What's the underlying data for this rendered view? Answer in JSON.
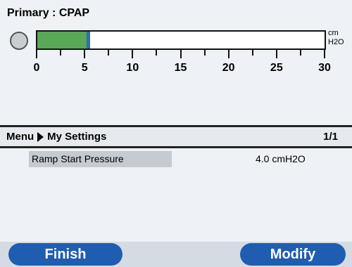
{
  "header": {
    "mode_title": "Primary : CPAP"
  },
  "pressure_gauge": {
    "value_cmH2O": 5.5,
    "min": 0,
    "max": 30,
    "unit_line1": "cm",
    "unit_line2": "H2O",
    "tick_labels": [
      "0",
      "5",
      "10",
      "15",
      "20",
      "25",
      "30"
    ],
    "fill_color": "#58a855",
    "marker_color": "#2c6fb4"
  },
  "menu": {
    "breadcrumb_root": "Menu",
    "breadcrumb_current": "My Settings",
    "page_indicator": "1/1"
  },
  "settings": [
    {
      "label": "Ramp Start Pressure",
      "value": "4.0 cmH2O"
    }
  ],
  "softkeys": {
    "left": "Finish",
    "right": "Modify",
    "color": "#1f5db0"
  }
}
